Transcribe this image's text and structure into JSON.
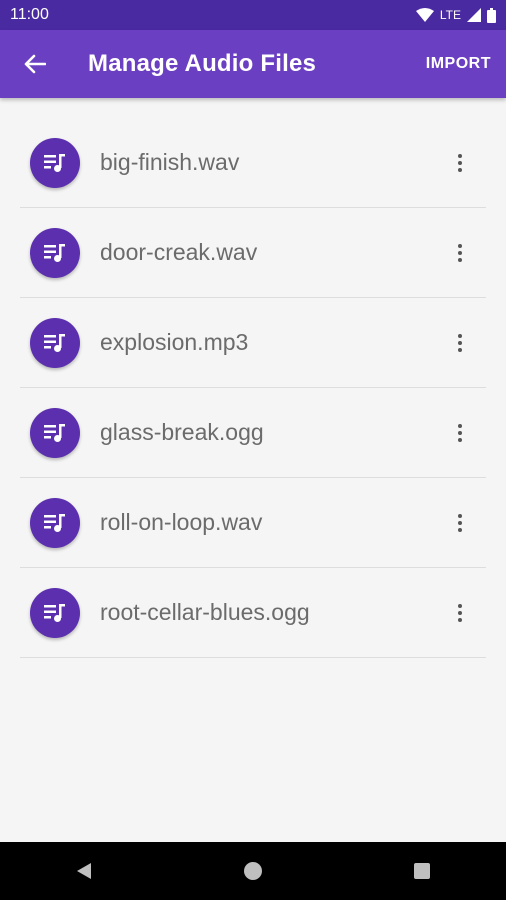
{
  "status_bar": {
    "time": "11:00",
    "network": "LTE",
    "icons": [
      "wifi-icon",
      "signal-icon",
      "battery-icon"
    ]
  },
  "app_bar": {
    "title": "Manage Audio Files",
    "back_icon": "arrow-left-icon",
    "import_label": "IMPORT"
  },
  "files": [
    {
      "name": "big-finish.wav"
    },
    {
      "name": "door-creak.wav"
    },
    {
      "name": "explosion.mp3"
    },
    {
      "name": "glass-break.ogg"
    },
    {
      "name": "roll-on-loop.wav"
    },
    {
      "name": "root-cellar-blues.ogg"
    }
  ],
  "nav_bar": {
    "icons": [
      "back-triangle-icon",
      "home-circle-icon",
      "recents-square-icon"
    ]
  },
  "colors": {
    "status_bar": "#4a2aa1",
    "app_bar": "#6a3fc1",
    "accent": "#5b2fae",
    "background": "#f5f5f5"
  }
}
